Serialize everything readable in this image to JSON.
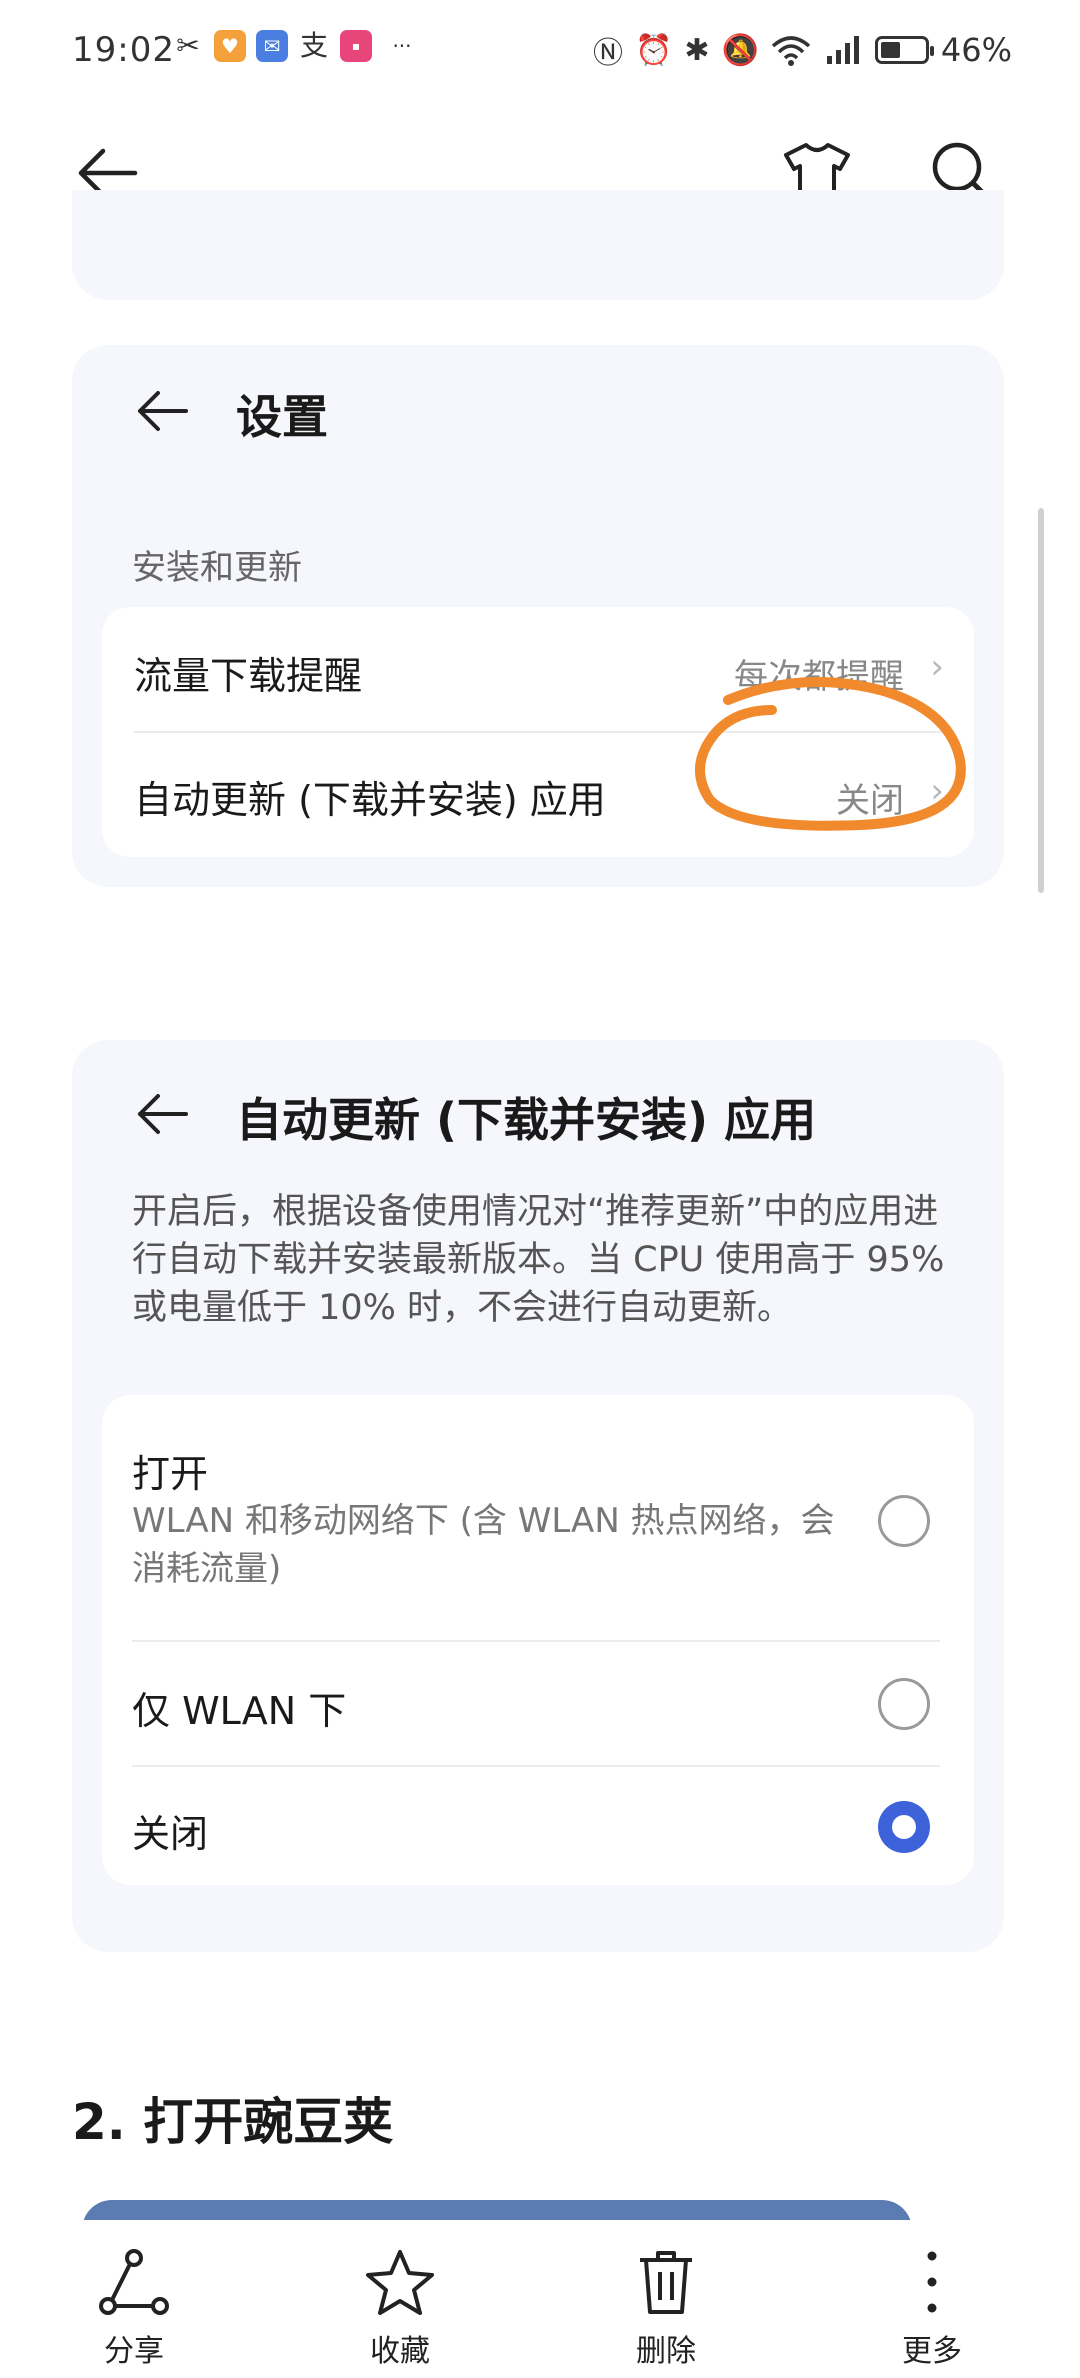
{
  "status_bar": {
    "time": "19:02",
    "left_icons": [
      "crossed-icon",
      "app-icon-orange",
      "app-icon-blue",
      "alipay-icon",
      "app-icon-pink"
    ],
    "more_indicator": "···",
    "right_glyphs": [
      "nfc-icon",
      "alarm-icon",
      "bluetooth-icon",
      "mute-icon",
      "wifi-icon",
      "signal-icon"
    ],
    "battery_level": 46,
    "battery_text": "46%"
  },
  "toolbar": {
    "back_icon": "arrow-left-icon",
    "shirt_icon": "tshirt-icon",
    "search_icon": "search-icon"
  },
  "settings_card": {
    "title": "设置",
    "section_header": "安装和更新",
    "rows": [
      {
        "label": "流量下载提醒",
        "value": "每次都提醒"
      },
      {
        "label": "自动更新 (下载并安装) 应用",
        "value": "关闭"
      }
    ]
  },
  "auto_update_card": {
    "title": "自动更新 (下载并安装) 应用",
    "description": "开启后，根据设备使用情况对“推荐更新”中的应用进行自动下载并安装最新版本。当 CPU 使用高于 95% 或电量低于 10% 时，不会进行自动更新。",
    "options": [
      {
        "label": "打开",
        "desc": "WLAN 和移动网络下 (含 WLAN 热点网络，会消耗流量)",
        "selected": false
      },
      {
        "label": "仅 WLAN 下",
        "desc": "",
        "selected": false
      },
      {
        "label": "关闭",
        "desc": "",
        "selected": true
      }
    ]
  },
  "step": {
    "title": "2.  打开豌豆荚"
  },
  "bottom_bar": {
    "items": [
      {
        "label": "分享",
        "icon": "share-icon"
      },
      {
        "label": "收藏",
        "icon": "star-icon"
      },
      {
        "label": "删除",
        "icon": "trash-icon"
      },
      {
        "label": "更多",
        "icon": "more-vertical-icon"
      }
    ]
  },
  "colors": {
    "accent": "#3d62d9",
    "annotation": "#f08a2c",
    "card_bg": "#f5f7fc"
  }
}
